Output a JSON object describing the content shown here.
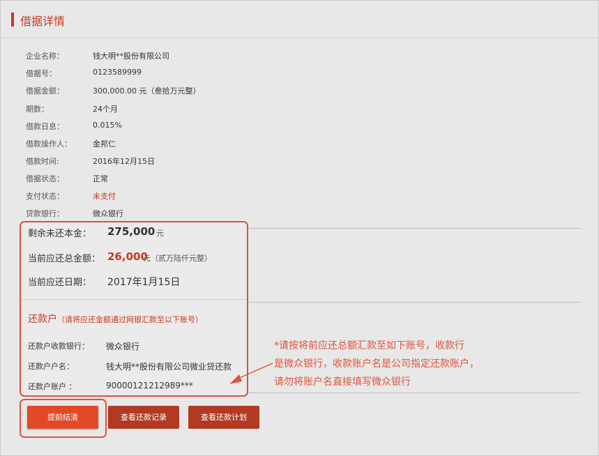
{
  "page_title": "借据详情",
  "details": [
    {
      "label": "企业名称：",
      "value": "钱大明**股份有限公司"
    },
    {
      "label": "借据号：",
      "value": "0123589999"
    },
    {
      "label": "借据金额：",
      "value": "300,000.00 元（叁拾万元整）"
    },
    {
      "label": "期数：",
      "value": "24个月"
    },
    {
      "label": "借款日息：",
      "value": "0.015%"
    },
    {
      "label": "借款操作人：",
      "value": "金邦仁"
    },
    {
      "label": "借款时间:",
      "value": "2016年12月15日"
    },
    {
      "label": "借据状态：",
      "value": "正常"
    },
    {
      "label": "支付状态：",
      "value": "未支付",
      "highlight": true
    },
    {
      "label": "贷款银行：",
      "value": "微众银行"
    }
  ],
  "summary": {
    "remaining_label": "剩余未还本金：",
    "remaining_value": "275,000",
    "remaining_unit": "元",
    "due_label": "当前应还总金额：",
    "due_value": "26,000",
    "due_unit": "元（贰万陆仟元整）",
    "date_label": "当前应还日期：",
    "date_value": "2017年1月15日"
  },
  "repayment_account": {
    "title": "还款户",
    "note": "（请将应还金额通过网银汇款至以下账号）",
    "bank_label": "还款户收款银行：",
    "bank_value": "微众银行",
    "name_label": "还款户户名：",
    "name_value": "钱大明**股份有限公司微业贷还款",
    "account_label": "还款户账户  ：",
    "account_value": "90000121212989***"
  },
  "buttons": {
    "prepay": "提前结清",
    "records": "查看还款记录",
    "plan": "查看还款计划"
  },
  "annotation": {
    "line1": "*请按将前应还总额汇款至如下账号，收款行",
    "line2": "是微众银行，收款账户名是公司指定还款账户，",
    "line3": "请勿将账户名直接填写微众银行"
  },
  "colors": {
    "accent": "#c8391f",
    "annotation": "#e0533a",
    "button_primary": "#e04a26",
    "button_dark": "#b23a22"
  }
}
